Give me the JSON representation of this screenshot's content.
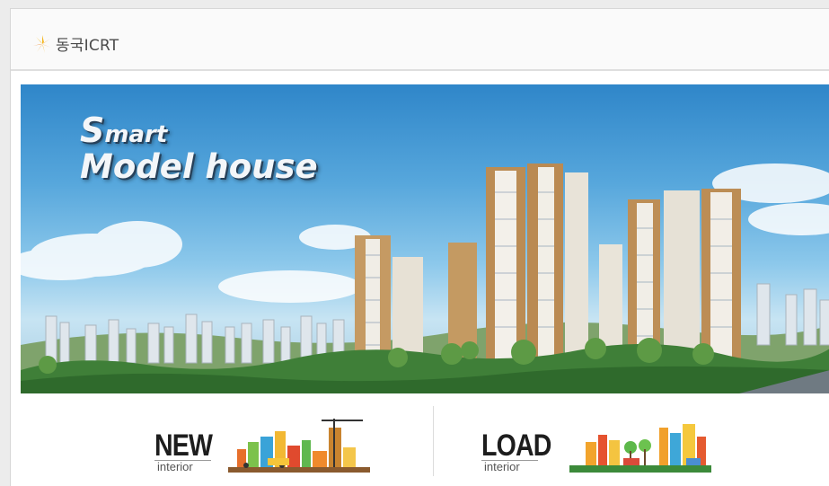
{
  "brand": {
    "name": "동국ICRT",
    "colors": {
      "orange": "#f2a12b",
      "yellow": "#f6d23a"
    }
  },
  "hero": {
    "title_first": "S",
    "title_rest": "mart",
    "title_line2": "Model house"
  },
  "menu": [
    {
      "label": "NEW",
      "sub": "interior",
      "icon": "construction-city-icon"
    },
    {
      "label": "LOAD",
      "sub": "interior",
      "icon": "city-park-icon"
    }
  ]
}
